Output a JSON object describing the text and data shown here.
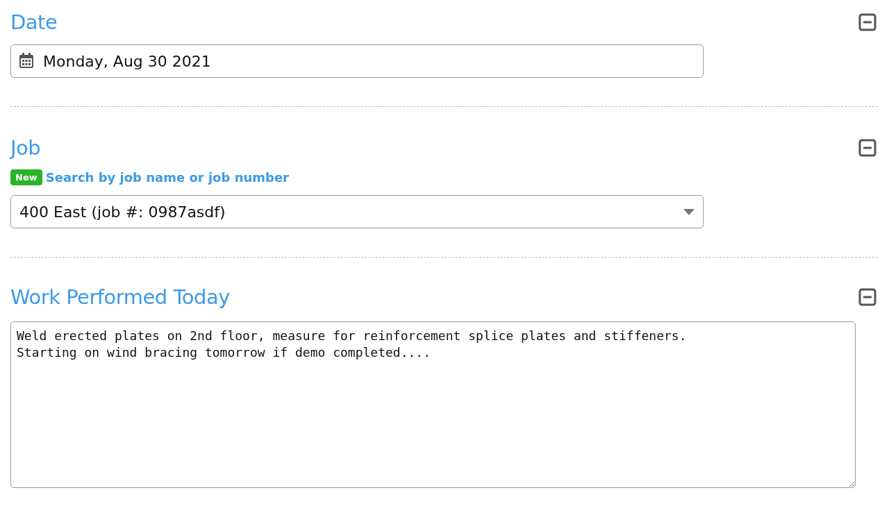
{
  "sections": [
    {
      "kind": "date",
      "title": "Date",
      "expanded": true,
      "field": {
        "value": "Monday, Aug 30 2021"
      }
    },
    {
      "kind": "select",
      "title": "Job",
      "expanded": true,
      "badge": "New",
      "link": "Search by job name or job number",
      "field": {
        "value": "400 East (job #: 0987asdf)"
      }
    },
    {
      "kind": "textarea",
      "title": "Work Performed Today",
      "expanded": true,
      "field": {
        "value": "Weld erected plates on 2nd floor, measure for reinforcement splice plates and stiffeners.\nStarting on wind bracing tomorrow if demo completed...."
      }
    }
  ]
}
